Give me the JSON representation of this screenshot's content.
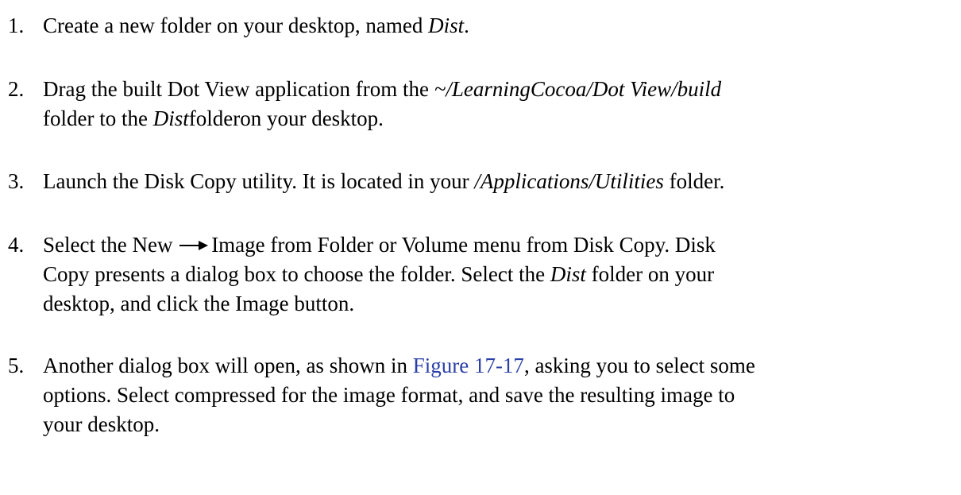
{
  "steps": [
    {
      "number": "1.",
      "lines": [
        {
          "t1": "Create a new folder on your desktop, named ",
          "i1": "Dist",
          "t2": "."
        }
      ]
    },
    {
      "number": "2.",
      "lines": [
        {
          "t1": "Drag the built Dot View application from the ",
          "i1": "~/LearningCocoa/Dot View/build"
        },
        {
          "t1": "folder to the ",
          "i1": "Dist",
          "t2": "folderon your desktop."
        }
      ]
    },
    {
      "number": "3.",
      "lines": [
        {
          "t1": "Launch the Disk Copy utility. It is located in your ",
          "i1": "/Applications/Utilities",
          "t2": " folder."
        }
      ]
    },
    {
      "number": "4.",
      "lines": [
        {
          "t1": "Select the New",
          "t2": "Image from Folder or Volume menu from Disk Copy. Disk"
        },
        {
          "t1": "Copy presents a dialog box to choose the folder. Select the ",
          "i1": "Dist",
          "t2": " folder on your"
        },
        {
          "t1": "desktop, and click the Image button."
        }
      ],
      "arrow_icon": "right-arrow-icon"
    },
    {
      "number": "5.",
      "lines": [
        {
          "t1": "Another dialog box will open, as shown in ",
          "link": "Figure 17-17",
          "t2": ", asking you to select some"
        },
        {
          "t1": "options. Select compressed for the image format, and save the resulting image to"
        },
        {
          "t1": "your desktop."
        }
      ],
      "link_color": "#2a3fa8"
    }
  ]
}
